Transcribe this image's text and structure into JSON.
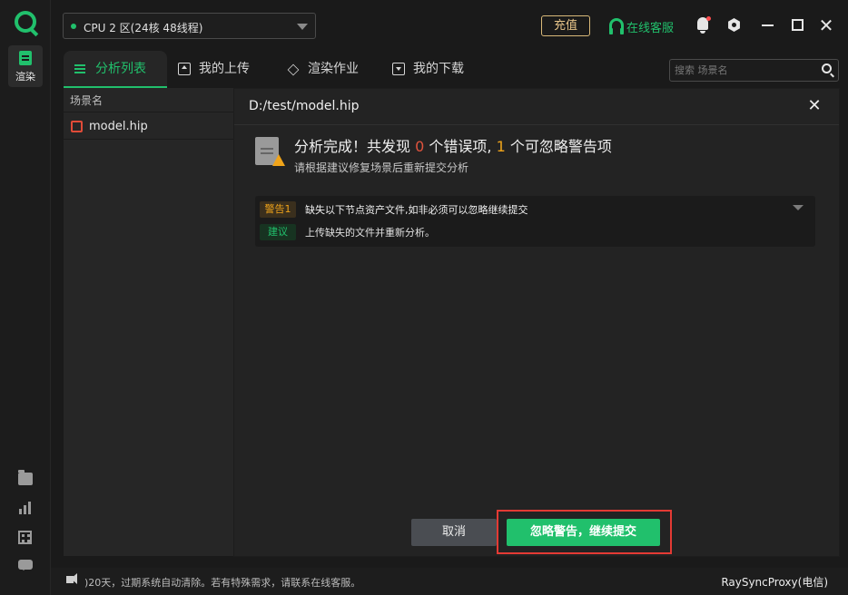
{
  "sidebar": {
    "render_label": "渲染"
  },
  "top": {
    "cpu": "CPU 2 区(24核 48线程)",
    "recharge": "充值",
    "support": "在线客服",
    "close_glyph": "✕"
  },
  "tabs": [
    {
      "label": "分析列表"
    },
    {
      "label": "我的上传"
    },
    {
      "label": "渲染作业"
    },
    {
      "label": "我的下载"
    }
  ],
  "search": {
    "placeholder": "搜索 场景名"
  },
  "list": {
    "header": "场景名",
    "file": "model.hip"
  },
  "dialog": {
    "title": "D:/test/model.hip",
    "close_glyph": "✕",
    "summary_prefix": "分析完成！共发现",
    "error_count": "0",
    "summary_middle": "个错误项,",
    "warning_count": "1",
    "summary_suffix": "个可忽略警告项",
    "hint": "请根据建议修复场景后重新提交分析",
    "warning_badge": "警告1",
    "warning_text": "缺失以下节点资产文件,如非必须可以忽略继续提交",
    "advice_badge": "建议",
    "advice_text": "上传缺失的文件并重新分析。",
    "cancel": "取消",
    "ignore_submit": "忽略警告，继续提交"
  },
  "footer": {
    "note": ")20天，过期系统自动清除。若有特殊需求，请联系在线客服。",
    "proxy": "RaySyncProxy(电信)"
  }
}
